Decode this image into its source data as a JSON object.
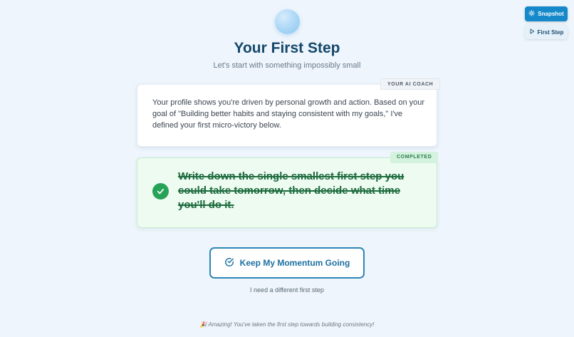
{
  "header": {
    "title": "Your First Step",
    "subtitle": "Let's start with something impossibly small"
  },
  "coach": {
    "tag": "YOUR AI COACH",
    "message": "Your profile shows you're driven by personal growth and action. Based on your goal of \"Building better habits and staying consistent with my goals,\" I've defined your first micro-victory below."
  },
  "task": {
    "tag": "COMPLETED",
    "text": "Write down the single smallest first step you could take tomorrow, then decide what time you'll do it."
  },
  "actions": {
    "momentum_label": "Keep My Momentum Going",
    "different_step_label": "I need a different first step"
  },
  "footer": {
    "message": "🎉 Amazing! You've taken the first step towards building consistency!"
  },
  "toolbar": {
    "snapshot_label": "Snapshot",
    "first_step_label": "First Step"
  },
  "colors": {
    "accent": "#1589c9",
    "success": "#27a358",
    "title": "#15486b"
  }
}
